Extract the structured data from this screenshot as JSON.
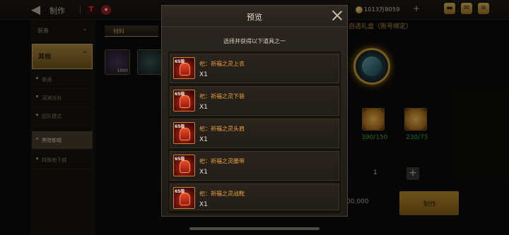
{
  "topbar": {
    "title": "制作",
    "gold": "1013万8059",
    "plus": "+"
  },
  "left_nav": {
    "tab": "装备",
    "category": "其他",
    "items": [
      {
        "label": "普通",
        "active": false
      },
      {
        "label": "深渊派对",
        "active": false
      },
      {
        "label": "团队模式",
        "active": false
      },
      {
        "label": "黑暗都城",
        "active": true
      },
      {
        "label": "特殊地下城",
        "active": false
      }
    ]
  },
  "middle": {
    "tab": "材料",
    "slots": [
      {
        "count": "1000"
      },
      {
        "count": ""
      }
    ]
  },
  "right": {
    "title": "自选礼盒（账号绑定）",
    "materials": [
      {
        "count": "390/150"
      },
      {
        "count": "230/75"
      }
    ],
    "quantity": "1",
    "price": "00,000",
    "make_button": "制作"
  },
  "modal": {
    "title": "预览",
    "instruction": "选择并获得以下道具之一",
    "items": [
      {
        "level": "65级",
        "name": "祀：祈福之灵上衣",
        "qty": "X1"
      },
      {
        "level": "65级",
        "name": "祀：祈福之灵下装",
        "qty": "X1"
      },
      {
        "level": "65级",
        "name": "祀：祈福之灵头肩",
        "qty": "X1"
      },
      {
        "level": "65级",
        "name": "祀：祈福之灵腰带",
        "qty": "X1"
      },
      {
        "level": "65级",
        "name": "祀：祈福之灵战靴",
        "qty": "X1"
      }
    ]
  },
  "colors": {
    "gold_accent": "#c99a3c",
    "item_name": "#f0a23a",
    "green_count": "#49b845"
  }
}
